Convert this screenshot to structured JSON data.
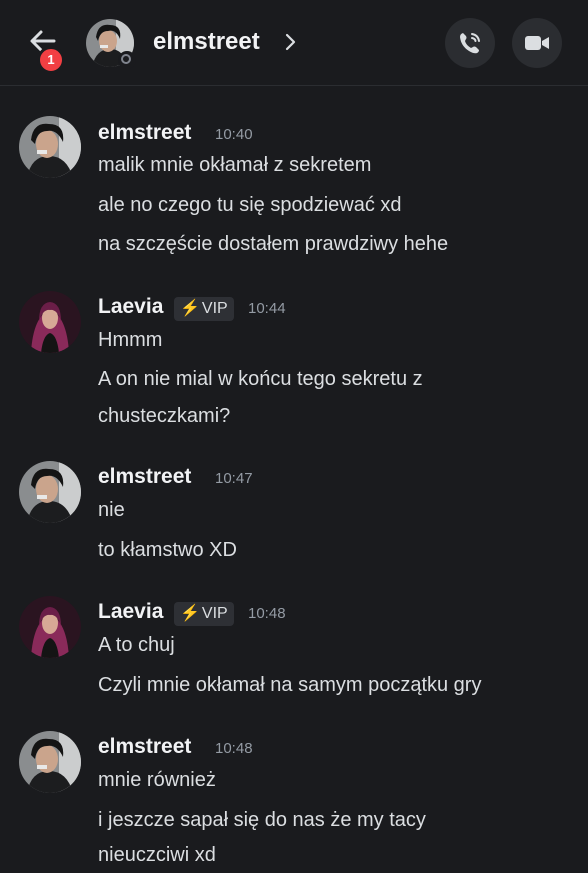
{
  "header": {
    "title": "elmstreet",
    "badge_count": "1"
  },
  "messages": [
    {
      "author": "elmstreet",
      "time": "10:40",
      "lines": [
        "malik mnie okłamał z sekretem",
        "ale no czego tu się spodziewać xd",
        "na szczęście dostałem prawdziwy hehe"
      ]
    },
    {
      "author": "Laevia",
      "badge": "VIP",
      "time": "10:44",
      "lines": [
        "Hmmm",
        "A on nie mial w końcu tego sekretu z",
        "chusteczkami?"
      ]
    },
    {
      "author": "elmstreet",
      "time": "10:47",
      "lines": [
        "nie",
        "to kłamstwo XD"
      ]
    },
    {
      "author": "Laevia",
      "badge": "VIP",
      "time": "10:48",
      "lines": [
        "A to chuj",
        "Czyli mnie okłamał na samym początku gry"
      ]
    },
    {
      "author": "elmstreet",
      "time": "10:48",
      "lines": [
        "mnie również",
        "i jeszcze sapał się do nas że my tacy",
        "nieuczciwi xd"
      ]
    }
  ],
  "icons": {
    "back": "arrow-left-icon",
    "chevron": "chevron-right-icon",
    "call": "phone-icon",
    "video": "video-camera-icon",
    "vip_bolt": "lightning-icon"
  },
  "colors": {
    "background": "#1a1b1e",
    "badge_red": "#f23f43",
    "bolt_yellow": "#f0b232",
    "timestamp_gray": "#949ba4"
  }
}
